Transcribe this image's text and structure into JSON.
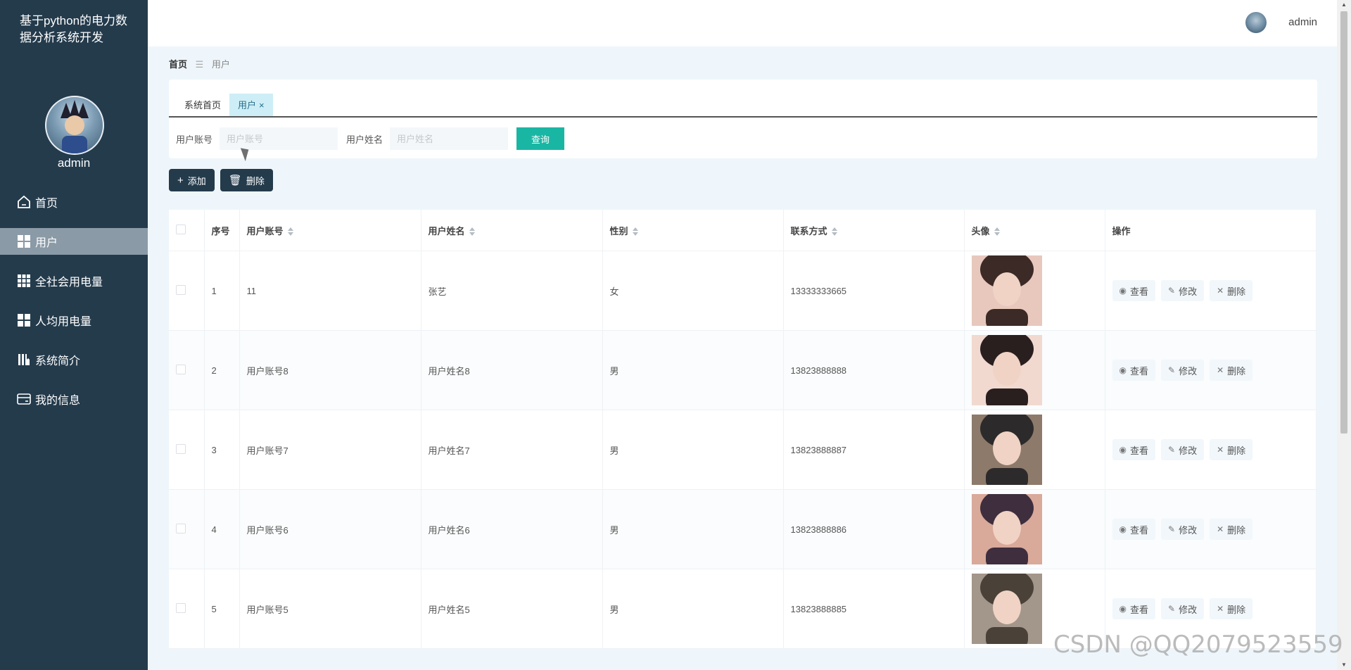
{
  "app": {
    "title": "基于python的电力数据分析系统开发"
  },
  "sidebar": {
    "username": "admin",
    "items": [
      {
        "label": "首页",
        "icon": "home-icon"
      },
      {
        "label": "用户",
        "icon": "grid-icon",
        "active": true
      },
      {
        "label": "全社会用电量",
        "icon": "grid-icon"
      },
      {
        "label": "人均用电量",
        "icon": "grid-icon"
      },
      {
        "label": "系统简介",
        "icon": "book-icon"
      },
      {
        "label": "我的信息",
        "icon": "card-icon"
      }
    ]
  },
  "header": {
    "username": "admin"
  },
  "breadcrumb": {
    "home": "首页",
    "current": "用户"
  },
  "tabs": [
    {
      "label": "系统首页"
    },
    {
      "label": "用户",
      "close": "×"
    }
  ],
  "search": {
    "account_label": "用户账号",
    "account_placeholder": "用户账号",
    "name_label": "用户姓名",
    "name_placeholder": "用户姓名",
    "query_label": "查询"
  },
  "actions": {
    "add_label": "添加",
    "delete_label": "删除"
  },
  "table": {
    "headers": {
      "index": "序号",
      "account": "用户账号",
      "name": "用户姓名",
      "gender": "性别",
      "phone": "联系方式",
      "avatar": "头像",
      "ops": "操作"
    },
    "ops": {
      "view": "查看",
      "edit": "修改",
      "delete": "删除"
    },
    "rows": [
      {
        "index": "1",
        "account": "11",
        "name": "张艺",
        "gender": "女",
        "phone": "13333333665",
        "photo_colors": [
          "#e8c8bd",
          "#3b2a26"
        ]
      },
      {
        "index": "2",
        "account": "用户账号8",
        "name": "用户姓名8",
        "gender": "男",
        "phone": "13823888888",
        "photo_colors": [
          "#f1d9cf",
          "#2a1f1f"
        ]
      },
      {
        "index": "3",
        "account": "用户账号7",
        "name": "用户姓名7",
        "gender": "男",
        "phone": "13823888887",
        "photo_colors": [
          "#8d7a6a",
          "#2d2a2b"
        ]
      },
      {
        "index": "4",
        "account": "用户账号6",
        "name": "用户姓名6",
        "gender": "男",
        "phone": "13823888886",
        "photo_colors": [
          "#d9a99a",
          "#3e2e3e"
        ]
      },
      {
        "index": "5",
        "account": "用户账号5",
        "name": "用户姓名5",
        "gender": "男",
        "phone": "13823888885",
        "photo_colors": [
          "#a3968a",
          "#4a4138"
        ]
      }
    ]
  },
  "watermark": "CSDN @QQ2079523559"
}
